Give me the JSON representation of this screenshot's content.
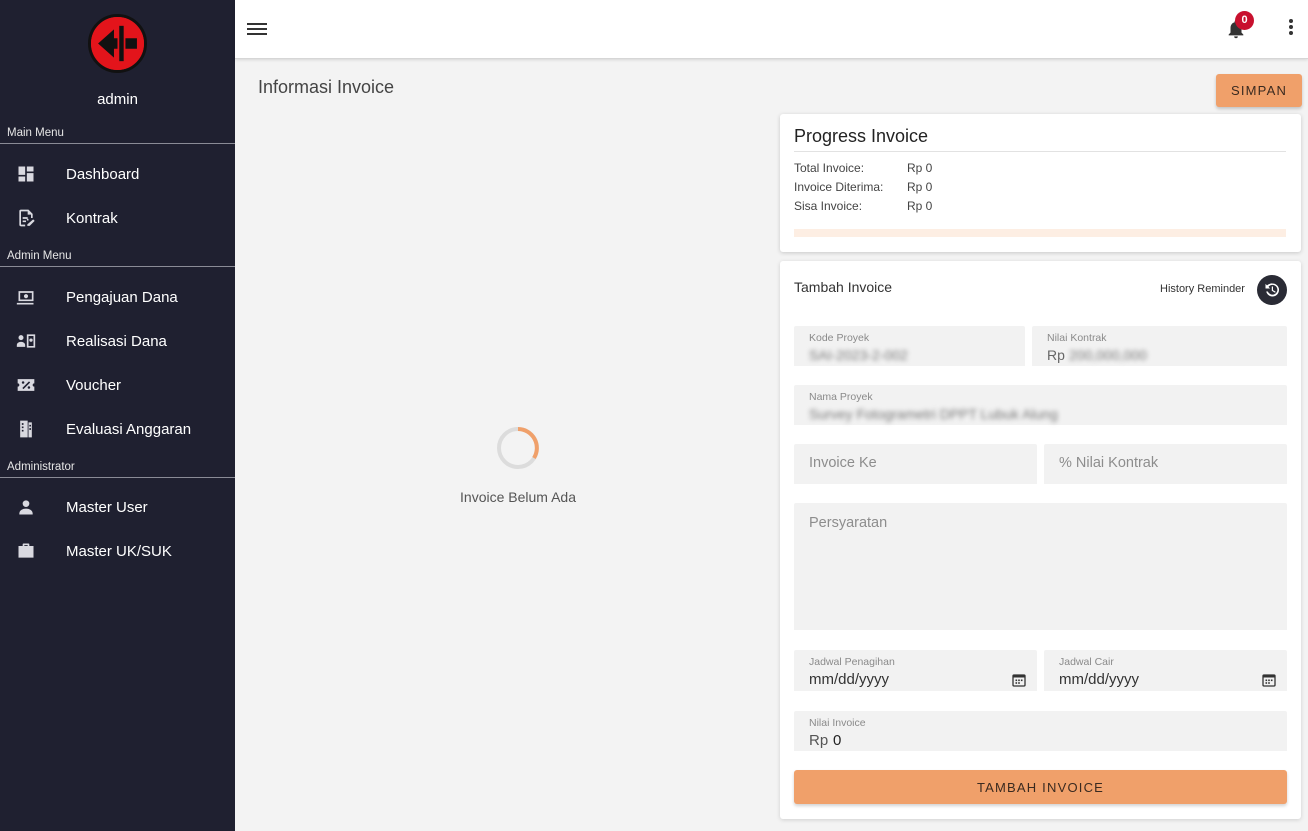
{
  "sidebar": {
    "user_name": "admin",
    "sections": [
      {
        "label": "Main Menu",
        "items": [
          {
            "label": "Dashboard",
            "icon": "dashboard-icon"
          },
          {
            "label": "Kontrak",
            "icon": "edit-document-icon"
          }
        ]
      },
      {
        "label": "Admin Menu",
        "items": [
          {
            "label": "Pengajuan Dana",
            "icon": "money-icon"
          },
          {
            "label": "Realisasi Dana",
            "icon": "transfer-icon"
          },
          {
            "label": "Voucher",
            "icon": "voucher-icon"
          },
          {
            "label": "Evaluasi Anggaran",
            "icon": "evaluation-icon"
          }
        ]
      },
      {
        "label": "Administrator",
        "items": [
          {
            "label": "Master User",
            "icon": "person-icon"
          },
          {
            "label": "Master UK/SUK",
            "icon": "briefcase-icon"
          }
        ]
      }
    ]
  },
  "topbar": {
    "notification_count": "0"
  },
  "main": {
    "page_title": "Informasi Invoice",
    "save_label": "SIMPAN",
    "empty_text": "Invoice Belum Ada"
  },
  "progress": {
    "title": "Progress Invoice",
    "rows": [
      {
        "label": "Total Invoice:",
        "value": "Rp 0"
      },
      {
        "label": "Invoice Diterima:",
        "value": "Rp 0"
      },
      {
        "label": "Sisa Invoice:",
        "value": "Rp 0"
      }
    ],
    "progress_fraction": 0
  },
  "form": {
    "title": "Tambah Invoice",
    "history_label": "History Reminder",
    "kode_proyek": {
      "label": "Kode Proyek",
      "value": "SAI-2023-2-002"
    },
    "nilai_kontrak": {
      "label": "Nilai Kontrak",
      "prefix": "Rp",
      "value": "200,000,000"
    },
    "nama_proyek": {
      "label": "Nama Proyek",
      "value": "Survey Fotogrametri DPPT Lubuk Alung"
    },
    "invoice_ke": {
      "placeholder": "Invoice Ke"
    },
    "persen_nilai_kontrak": {
      "placeholder": "% Nilai Kontrak"
    },
    "persyaratan": {
      "placeholder": "Persyaratan"
    },
    "jadwal_penagihan": {
      "label": "Jadwal Penagihan",
      "value": "mm/dd/yyyy"
    },
    "jadwal_cair": {
      "label": "Jadwal Cair",
      "value": "mm/dd/yyyy"
    },
    "nilai_invoice": {
      "label": "Nilai Invoice",
      "prefix": "Rp",
      "value": "0"
    },
    "submit_label": "TAMBAH INVOICE"
  },
  "colors": {
    "sidebar_bg": "#1f2030",
    "accent": "#f0a06a",
    "badge": "#c8102e",
    "logo_red": "#e3141b"
  }
}
